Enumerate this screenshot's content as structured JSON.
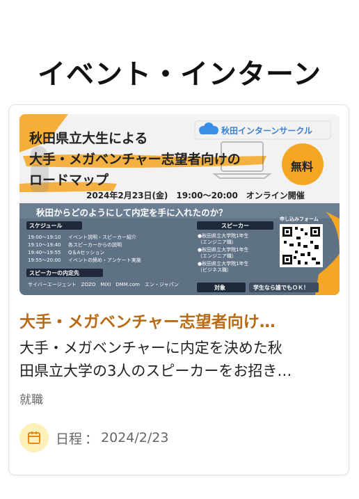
{
  "page": {
    "title": "イベント・インターン"
  },
  "card": {
    "title": "大手・メガベンチャー志望者向け…",
    "description_line1": "大手・メガベンチャーに内定を決めた秋",
    "description_line2": "田県立大学の3人のスピーカーをお招き…",
    "category": "就職",
    "schedule_label": "日程",
    "schedule_sep": "：",
    "schedule_date": "2024/2/23",
    "colors": {
      "title": "#b86a14",
      "calendar_bg": "#fdf0b8",
      "calendar_icon": "#e08a1e"
    }
  },
  "banner": {
    "title_line1": "秋田県立大生による",
    "title_line2": "大手・メガベンチャー志望者向けの",
    "title_line3": "ロードマップ",
    "logo_text": "秋田インターンサークル",
    "free_badge": "無料",
    "datetime": "2024年2月23日(金)　19:00〜20:00　オンライン開催",
    "question": "秋田からどのようにして内定を手に入れたのか？",
    "schedule_heading": "スケジュール",
    "schedule_items": [
      {
        "time": "19:00〜19:10",
        "text": "イベント説明・スピーカー紹介"
      },
      {
        "time": "19:10〜19:40",
        "text": "各スピーカーからの説明"
      },
      {
        "time": "19:40〜19:55",
        "text": "Q＆Aセッション"
      },
      {
        "time": "19:55〜20:00",
        "text": "イベントの締め・アンケート実施"
      }
    ],
    "speaker_heading": "スピーカー",
    "speakers": [
      {
        "name": "●秋田県立大学院1年生",
        "role": "（エンジニア職）"
      },
      {
        "name": "●秋田県立大学院1年生",
        "role": "（エンジニア職）"
      },
      {
        "name": "●秋田県立大学院1年生",
        "role": "（ビジネス職）"
      }
    ],
    "form_label": "申し込みフォーム",
    "offers_heading": "スピーカーの内定先",
    "offers": "サイバーエージェント　ZOZO　MIXI　DMM.com　エン・ジャパン",
    "target_heading": "対象",
    "target_text": "学生なら誰でもＯＫ！",
    "colors": {
      "bg": "#f2f2f2",
      "panel": "#5f7184",
      "orange": "#f5a623",
      "dark": "#222222"
    }
  }
}
